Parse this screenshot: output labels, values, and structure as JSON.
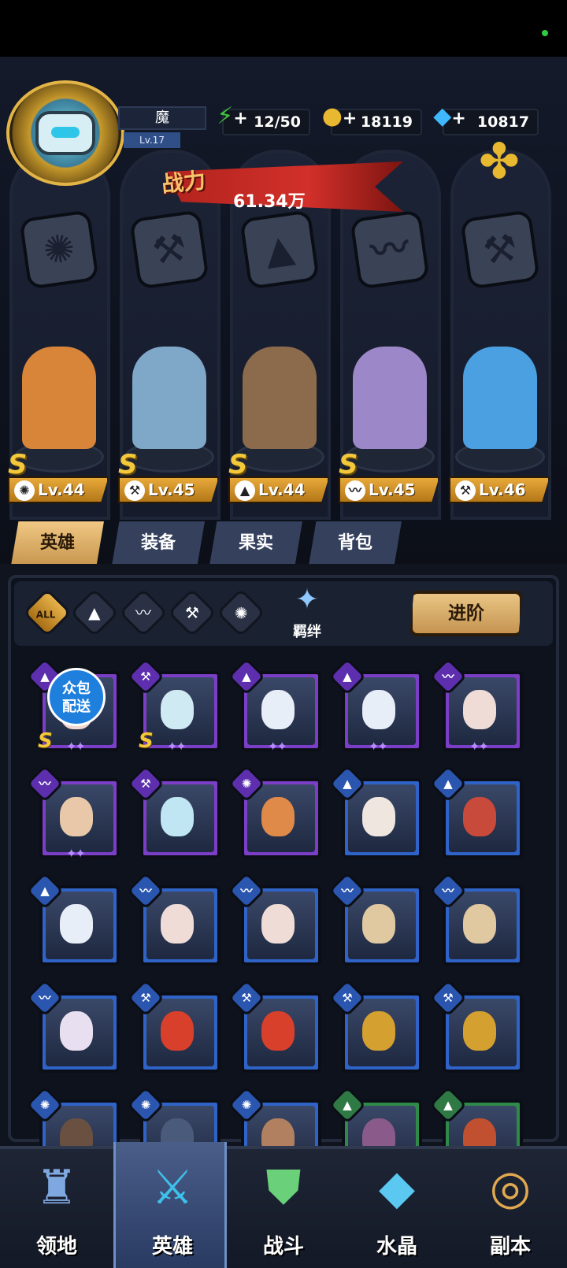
{
  "player": {
    "name": "魔",
    "level": "Lv.17"
  },
  "resources": {
    "stamina": {
      "value": "12/50",
      "icon": "lightning-icon",
      "color": "#3ec43a"
    },
    "gold": {
      "value": "18119",
      "icon": "coin-icon",
      "color": "#e8b830"
    },
    "diamond": {
      "value": "10817",
      "icon": "diamond-icon",
      "color": "#3fb8ff"
    }
  },
  "power": {
    "label": "战力",
    "value": "61.34万"
  },
  "lineup": [
    {
      "grade": "S",
      "level": "Lv.44",
      "type_icon": "beast-icon",
      "body_color": "#d8853a"
    },
    {
      "grade": "S",
      "level": "Lv.45",
      "type_icon": "wrench-icon",
      "body_color": "#7fa8c8"
    },
    {
      "grade": "S",
      "level": "Lv.44",
      "type_icon": "cone-icon",
      "body_color": "#8c6a4c"
    },
    {
      "grade": "S",
      "level": "Lv.45",
      "type_icon": "wing-icon",
      "body_color": "#9c88c8"
    },
    {
      "grade": "",
      "level": "Lv.46",
      "type_icon": "wrench-icon",
      "body_color": "#4aa0e0"
    }
  ],
  "tabs": [
    "英雄",
    "装备",
    "果实",
    "背包"
  ],
  "filters": {
    "all": "ALL",
    "bond": "羁绊",
    "advance": "进阶"
  },
  "delivery_badge": {
    "line1": "众包",
    "line2": "配送"
  },
  "hero_cards": [
    {
      "frame": "purple",
      "type": "cone",
      "grade": "S",
      "stars": "✦✦",
      "face": "#f2d6d0"
    },
    {
      "frame": "purple",
      "type": "wrench",
      "grade": "S",
      "stars": "✦✦",
      "face": "#cfeaf3"
    },
    {
      "frame": "purple",
      "type": "cone",
      "grade": "",
      "stars": "✦✦",
      "face": "#e8eef8"
    },
    {
      "frame": "purple",
      "type": "cone",
      "grade": "",
      "stars": "✦✦",
      "face": "#e8eef8"
    },
    {
      "frame": "purple",
      "type": "wing",
      "grade": "",
      "stars": "✦✦",
      "face": "#f0dcd6"
    },
    {
      "frame": "purple",
      "type": "wing",
      "grade": "",
      "stars": "✦✦",
      "face": "#e8c8a8"
    },
    {
      "frame": "purple",
      "type": "wrench",
      "grade": "",
      "stars": "",
      "face": "#bfe6f2"
    },
    {
      "frame": "purple",
      "type": "beast",
      "grade": "",
      "stars": "",
      "face": "#e08a4a"
    },
    {
      "frame": "blue",
      "type": "cone",
      "grade": "",
      "stars": "",
      "face": "#f0e6e0"
    },
    {
      "frame": "blue",
      "type": "cone",
      "grade": "",
      "stars": "",
      "face": "#c84a3a"
    },
    {
      "frame": "blue",
      "type": "cone",
      "grade": "",
      "stars": "",
      "face": "#e8eef8"
    },
    {
      "frame": "blue",
      "type": "wing",
      "grade": "",
      "stars": "",
      "face": "#f0dcd6"
    },
    {
      "frame": "blue",
      "type": "wing",
      "grade": "",
      "stars": "",
      "face": "#f0dcd6"
    },
    {
      "frame": "blue",
      "type": "wing",
      "grade": "",
      "stars": "",
      "face": "#e0c8a0"
    },
    {
      "frame": "blue",
      "type": "wing",
      "grade": "",
      "stars": "",
      "face": "#e0c8a0"
    },
    {
      "frame": "blue",
      "type": "wing",
      "grade": "",
      "stars": "",
      "face": "#e8e0f0"
    },
    {
      "frame": "blue",
      "type": "wrench",
      "grade": "",
      "stars": "",
      "face": "#d8402c"
    },
    {
      "frame": "blue",
      "type": "wrench",
      "grade": "",
      "stars": "",
      "face": "#d8402c"
    },
    {
      "frame": "blue",
      "type": "wrench",
      "grade": "",
      "stars": "",
      "face": "#d4a030"
    },
    {
      "frame": "blue",
      "type": "wrench",
      "grade": "",
      "stars": "",
      "face": "#d4a030"
    },
    {
      "frame": "blue",
      "type": "beast",
      "grade": "",
      "stars": "",
      "face": "#6a5040"
    },
    {
      "frame": "blue",
      "type": "beast",
      "grade": "",
      "stars": "",
      "face": "#4a5a7a"
    },
    {
      "frame": "blue",
      "type": "beast",
      "grade": "",
      "stars": "",
      "face": "#b08060"
    },
    {
      "frame": "green",
      "type": "cone",
      "grade": "",
      "stars": "",
      "face": "#8a5a8a"
    },
    {
      "frame": "green",
      "type": "cone",
      "grade": "",
      "stars": "",
      "face": "#c05030"
    }
  ],
  "nav": [
    {
      "label": "领地",
      "icon": "castle-icon"
    },
    {
      "label": "英雄",
      "icon": "hero-icon",
      "active": true
    },
    {
      "label": "战斗",
      "icon": "battle-icon"
    },
    {
      "label": "水晶",
      "icon": "crystal-icon"
    },
    {
      "label": "副本",
      "icon": "dungeon-icon"
    }
  ]
}
